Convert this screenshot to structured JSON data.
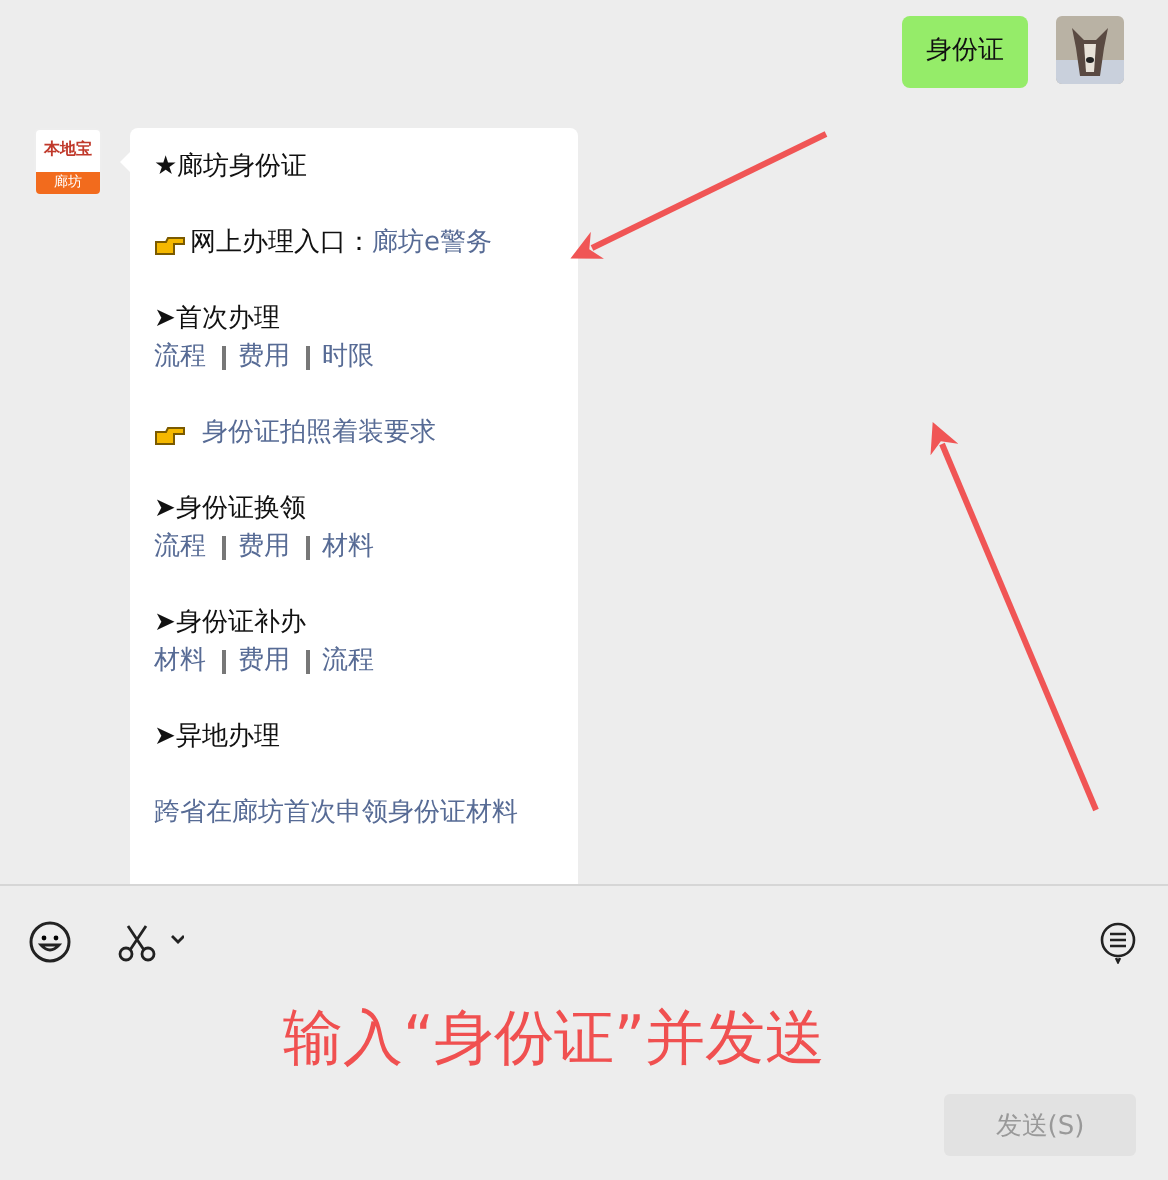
{
  "messages": [
    {
      "kind": "sent",
      "text": "身份证"
    },
    {
      "kind": "received",
      "avatar": {
        "kind": "logo",
        "brand": "本地宝",
        "city": "廊坊"
      },
      "blocks": [
        {
          "kind": "title",
          "text": "★廊坊身份证"
        },
        {
          "kind": "pointer",
          "text": "网上办理入口：",
          "link": "廊坊e警务"
        },
        {
          "kind": "section",
          "title": "➤首次办理",
          "links": [
            "流程",
            "费用",
            "时限"
          ]
        },
        {
          "kind": "pointer",
          "link": "身份证拍照着装要求"
        },
        {
          "kind": "section",
          "title": "➤身份证换领",
          "links": [
            "流程",
            "费用",
            "材料"
          ]
        },
        {
          "kind": "section",
          "title": "➤身份证补办",
          "links": [
            "材料",
            "费用",
            "流程"
          ]
        },
        {
          "kind": "section",
          "title": "➤异地办理"
        },
        {
          "kind": "links",
          "links": [
            "跨省在廊坊首次申领身份证材料"
          ]
        }
      ]
    }
  ],
  "annotation": "输入“身份证”并发送",
  "send_button": "发送(S)"
}
